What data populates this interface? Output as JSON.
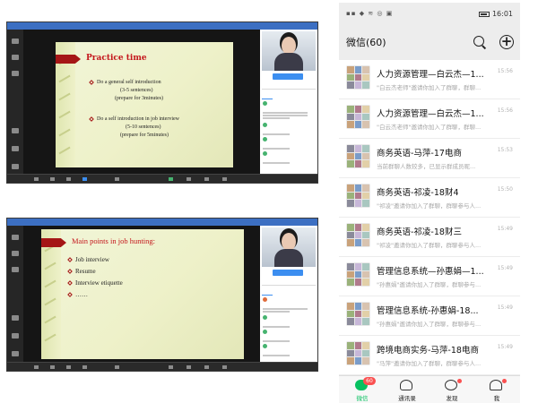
{
  "conference_top": {
    "slide_title": "Practice time",
    "lines": [
      "Do a general self introduction",
      "(3-5 sentences)",
      "(prepare for 3minutes)",
      "Do a self introduction in job interview",
      "(5-10 sentences)",
      "(prepare for 5minutes)"
    ]
  },
  "conference_bottom": {
    "slide_title": "Main points in job hunting:",
    "bullets": [
      "Job interview",
      "Resume",
      "Interview etiquette",
      "……"
    ]
  },
  "phone": {
    "status_time": "16:01",
    "title": "微信(60)",
    "chats": [
      {
        "name": "人力资源管理—白云杰—1...",
        "preview": "\"白云杰老师\"邀请你加入了群聊，群聊...",
        "time": "15:56"
      },
      {
        "name": "人力资源管理—白云杰—1...",
        "preview": "\"白云杰老师\"邀请你加入了群聊，群聊...",
        "time": "15:56"
      },
      {
        "name": "商务英语-马萍-17电商",
        "preview": "当前群聊人数较多，已显示群成员昵...",
        "time": "15:53"
      },
      {
        "name": "商务英语-祁凌-18财4",
        "preview": "\"祁凌\"邀请你加入了群聊，群聊参与人...",
        "time": "15:50"
      },
      {
        "name": "商务英语-祁凌-18财三",
        "preview": "\"祁凌\"邀请你加入了群聊，群聊参与人...",
        "time": "15:49"
      },
      {
        "name": "管理信息系统—孙惠娟—1...",
        "preview": "\"孙惠娟\"邀请你加入了群聊，群聊参与...",
        "time": "15:49"
      },
      {
        "name": "管理信息系统-孙惠娟-18...",
        "preview": "\"孙惠娟\"邀请你加入了群聊，群聊参与...",
        "time": "15:49"
      },
      {
        "name": "跨境电商实务-马萍-18电商",
        "preview": "\"马萍\"邀请你加入了群聊，群聊参与人...",
        "time": "15:49"
      }
    ],
    "tabs": [
      {
        "label": "微信",
        "badge": "60"
      },
      {
        "label": "通讯录"
      },
      {
        "label": "发现"
      },
      {
        "label": "我"
      }
    ]
  }
}
